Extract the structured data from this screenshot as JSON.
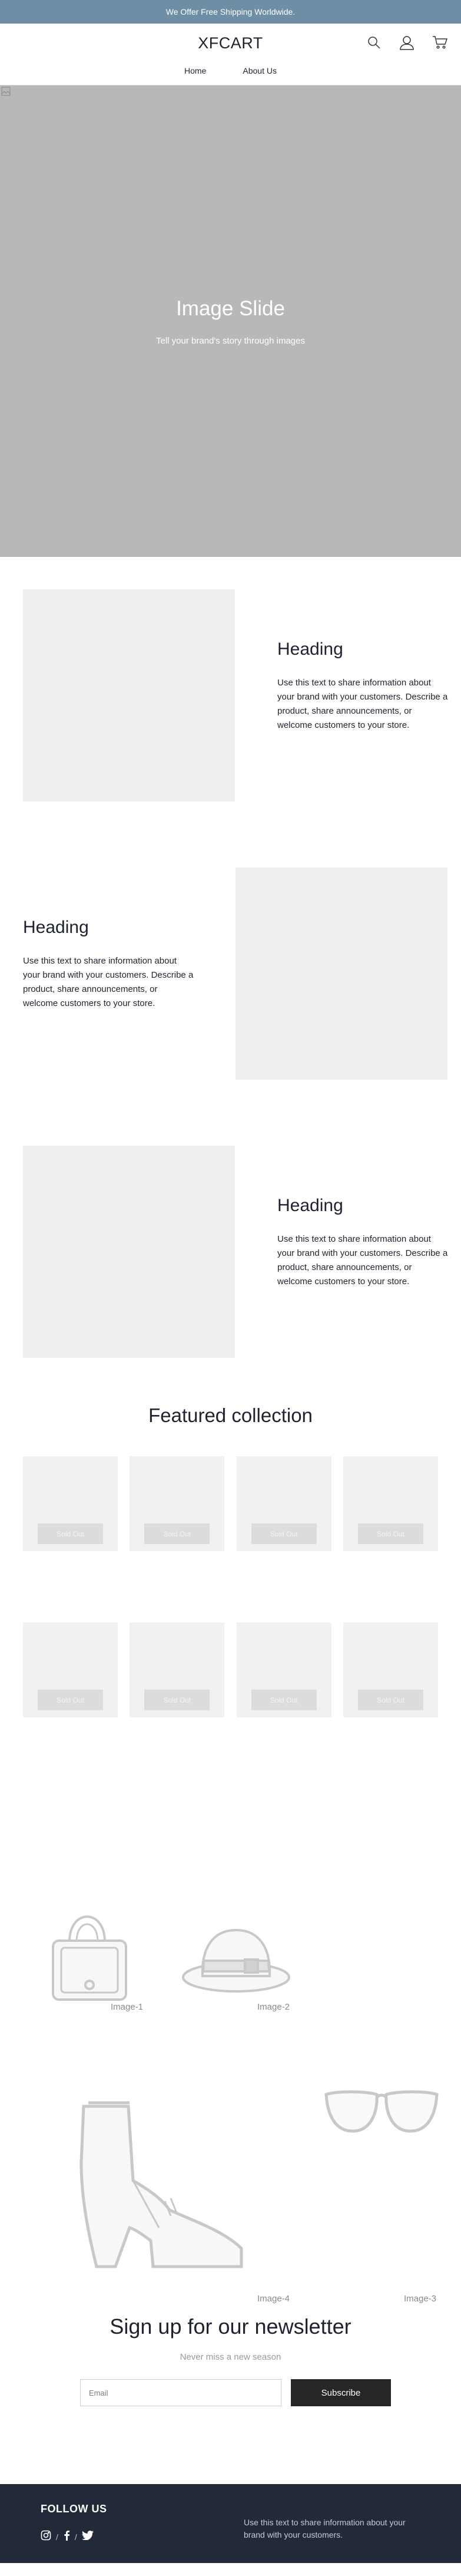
{
  "announcement": {
    "text": "We Offer Free Shipping Worldwide."
  },
  "header": {
    "logo": "XFCART",
    "icons": [
      "search-icon",
      "account-icon",
      "cart-icon"
    ]
  },
  "nav": {
    "items": [
      {
        "label": "Home"
      },
      {
        "label": "About Us"
      }
    ]
  },
  "hero": {
    "title": "Image Slide",
    "subtitle": "Tell your brand's story through images"
  },
  "image_text_sections": [
    {
      "heading": "Heading",
      "body": "Use this text to share information about your brand with your customers. Describe a product, share announcements, or welcome customers to your store."
    },
    {
      "heading": "Heading",
      "body": "Use this text to share information about your brand with your customers. Describe a product, share announcements, or welcome customers to your store."
    },
    {
      "heading": "Heading",
      "body": "Use this text to share information about your brand with your customers. Describe a product, share announcements, or welcome customers to your store."
    }
  ],
  "featured": {
    "title": "Featured collection",
    "products": [
      {
        "badge": "Sold Out"
      },
      {
        "badge": "Sold Out"
      },
      {
        "badge": "Sold Out"
      },
      {
        "badge": "Sold Out"
      },
      {
        "badge": "Sold Out"
      },
      {
        "badge": "Sold Out"
      },
      {
        "badge": "Sold Out"
      },
      {
        "badge": "Sold Out"
      }
    ]
  },
  "gallery": {
    "captions": [
      "Image-1",
      "Image-2",
      "Image-4",
      "Image-3"
    ],
    "images": [
      "handbag-image",
      "hat-image",
      "high-heel-shoe-image",
      "sunglasses-image"
    ]
  },
  "newsletter": {
    "title": "Sign up for our newsletter",
    "subtitle": "Never miss a new season",
    "email_placeholder": "Email",
    "button_label": "Subscribe"
  },
  "footer": {
    "follow_title": "FOLLOW US",
    "social_icons": [
      "instagram-icon",
      "facebook-icon",
      "twitter-icon"
    ],
    "separator": "/",
    "about_text": "Use this text to share information about your brand with your customers."
  },
  "colors": {
    "announcement_bg": "#6d8ea4",
    "hero_bg": "#b8b8b8",
    "footer_bg": "#222a3a",
    "subscribe_bg": "#262626"
  }
}
